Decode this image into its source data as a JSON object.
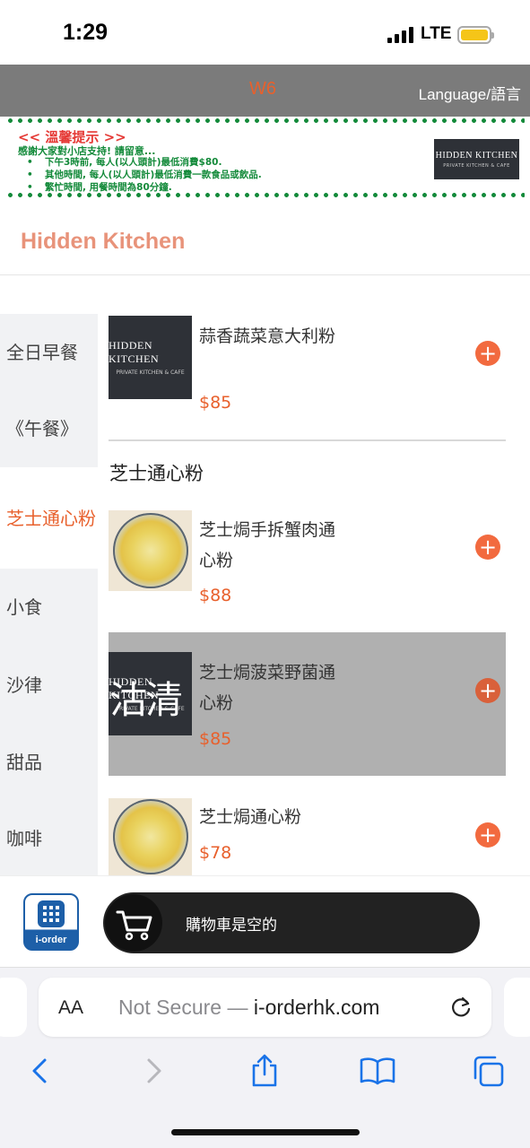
{
  "status_bar": {
    "time": "1:29",
    "network": "LTE"
  },
  "header": {
    "table_code": "W6",
    "language_label": "Language/語言"
  },
  "notice": {
    "title": "<< 溫馨提示 >>",
    "intro": "感謝大家對小店支持! 請留意...",
    "items": [
      "下午3時前, 每人(以人頭計)最低消費$80.",
      "其他時間, 每人(以人頭計)最低消費一款食品或飲品.",
      "繁忙時間, 用餐時間為80分鐘."
    ],
    "logo_text": "HIDDEN KITCHEN",
    "logo_subtext": "PRIVATE KITCHEN & CAFE"
  },
  "shop_name": "Hidden Kitchen",
  "categories": [
    "全日早餐",
    "《午餐》",
    "芝士通心粉",
    "小食",
    "沙律",
    "甜品",
    "咖啡"
  ],
  "active_category": "芝士通心粉",
  "prev_item": {
    "name": "蒜香蔬菜意大利粉",
    "price": "$85",
    "thumb_text": "HIDDEN KITCHEN",
    "thumb_subtext": "PRIVATE KITCHEN & CAFE"
  },
  "section": {
    "title": "芝士通心粉",
    "items": [
      {
        "name": "芝士焗手拆蟹肉通心粉",
        "price": "$88",
        "status": "available"
      },
      {
        "name": "芝士焗菠菜野菌通心粉",
        "price": "$85",
        "status": "sold_out",
        "overlay_label": "沽清"
      },
      {
        "name": "芝士焗通心粉",
        "price": "$78",
        "status": "available"
      }
    ]
  },
  "cart": {
    "empty_label": "購物車是空的",
    "brand_label": "i-order"
  },
  "browser": {
    "aa_label": "AA",
    "url_prefix": "Not Secure — ",
    "url_host": "i-orderhk.com"
  },
  "colors": {
    "accent": "#e8602c",
    "header_bg": "#7b7b7b",
    "notice_green": "#138a3a",
    "notice_red": "#e53935",
    "add_button": "#f26a3f",
    "brand_blue": "#1d5fa8"
  }
}
